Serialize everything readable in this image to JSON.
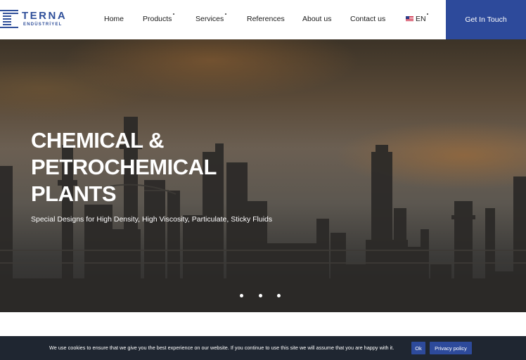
{
  "header": {
    "logo": {
      "name": "TERNA",
      "subtitle": "ENDÜSTRİYEL"
    },
    "nav": [
      {
        "label": "Home"
      },
      {
        "label": "Products"
      },
      {
        "label": "Services"
      },
      {
        "label": "References"
      },
      {
        "label": "About us"
      },
      {
        "label": "Contact us"
      }
    ],
    "language": {
      "label": "EN",
      "icon": "us-flag-icon"
    },
    "cta_label": "Get In Touch"
  },
  "hero": {
    "title_lines": [
      "CHEMICAL &",
      "PETROCHEMICAL",
      "PLANTS"
    ],
    "subtitle": "Special Designs for High Density, High Viscosity, Particulate, Sticky Fluids",
    "slides": 3
  },
  "cookie": {
    "text": "We use cookies to ensure that we give you the best experience on our website. If you continue to use this site we will assume that you are happy with it.",
    "ok_label": "Ok",
    "privacy_label": "Privacy policy"
  },
  "colors": {
    "brand": "#2d4a9b",
    "cookie_bg": "#1f2631",
    "nav_text": "#1a1a1a"
  }
}
